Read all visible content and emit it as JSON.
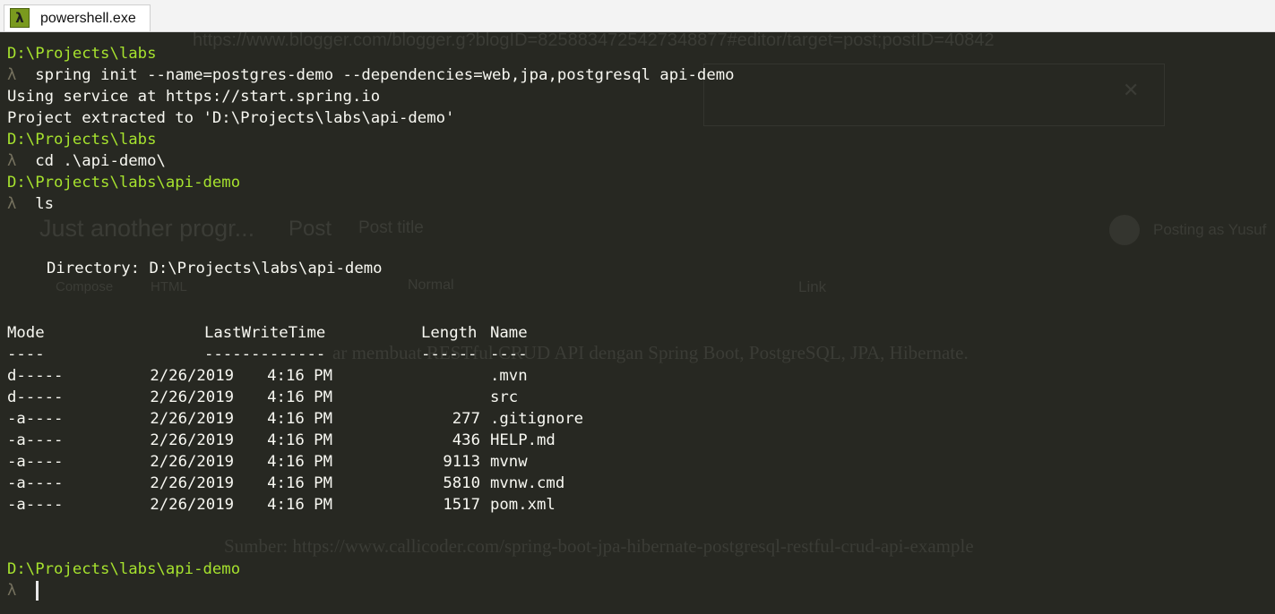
{
  "tab": {
    "title": "powershell.exe",
    "icon": "lambda-icon",
    "icon_glyph": "λ"
  },
  "colors": {
    "background": "#272822",
    "prompt": "#a6e22e",
    "text": "#f8f8f2",
    "lambda": "#75715e"
  },
  "lambda_glyph": "λ",
  "session": {
    "prompt1": "D:\\Projects\\labs",
    "cmd1": "spring init --name=postgres-demo --dependencies=web,jpa,postgresql api-demo",
    "out1": "Using service at https://start.spring.io",
    "out2": "Project extracted to 'D:\\Projects\\labs\\api-demo'",
    "prompt2": "D:\\Projects\\labs",
    "cmd2": "cd .\\api-demo\\",
    "prompt3": "D:\\Projects\\labs\\api-demo",
    "cmd3": "ls",
    "directory_line": "Directory: D:\\Projects\\labs\\api-demo",
    "prompt4": "D:\\Projects\\labs\\api-demo"
  },
  "listing": {
    "headers": {
      "mode": "Mode",
      "lastwritetime": "LastWriteTime",
      "length": "Length",
      "name": "Name"
    },
    "underlines": {
      "mode": "----",
      "lastwritetime": "-------------",
      "length": "------",
      "name": "----"
    },
    "rows": [
      {
        "mode": "d-----",
        "date": "2/26/2019",
        "time": "4:16 PM",
        "length": "",
        "name": ".mvn"
      },
      {
        "mode": "d-----",
        "date": "2/26/2019",
        "time": "4:16 PM",
        "length": "",
        "name": "src"
      },
      {
        "mode": "-a----",
        "date": "2/26/2019",
        "time": "4:16 PM",
        "length": "277",
        "name": ".gitignore"
      },
      {
        "mode": "-a----",
        "date": "2/26/2019",
        "time": "4:16 PM",
        "length": "436",
        "name": "HELP.md"
      },
      {
        "mode": "-a----",
        "date": "2/26/2019",
        "time": "4:16 PM",
        "length": "9113",
        "name": "mvnw"
      },
      {
        "mode": "-a----",
        "date": "2/26/2019",
        "time": "4:16 PM",
        "length": "5810",
        "name": "mvnw.cmd"
      },
      {
        "mode": "-a----",
        "date": "2/26/2019",
        "time": "4:16 PM",
        "length": "1517",
        "name": "pom.xml"
      }
    ]
  },
  "background_ghost": {
    "url": "https://www.blogger.com/blogger.g?blogID=8258834725427348877#editor/target=post;postID=40842",
    "blog_title": "Just another progr...",
    "post_label": "Post",
    "post_title_placeholder": "Post title",
    "posting_as": "Posting as Yusuf",
    "compose": "Compose",
    "html": "HTML",
    "normal": "Normal",
    "link": "Link",
    "heading_text": "ar membuat RESTful CRUD API dengan Spring Boot, PostgreSQL, JPA, Hibernate.",
    "source_text": "Sumber: https://www.callicoder.com/spring-boot-jpa-hibernate-postgresql-restful-crud-api-example"
  }
}
